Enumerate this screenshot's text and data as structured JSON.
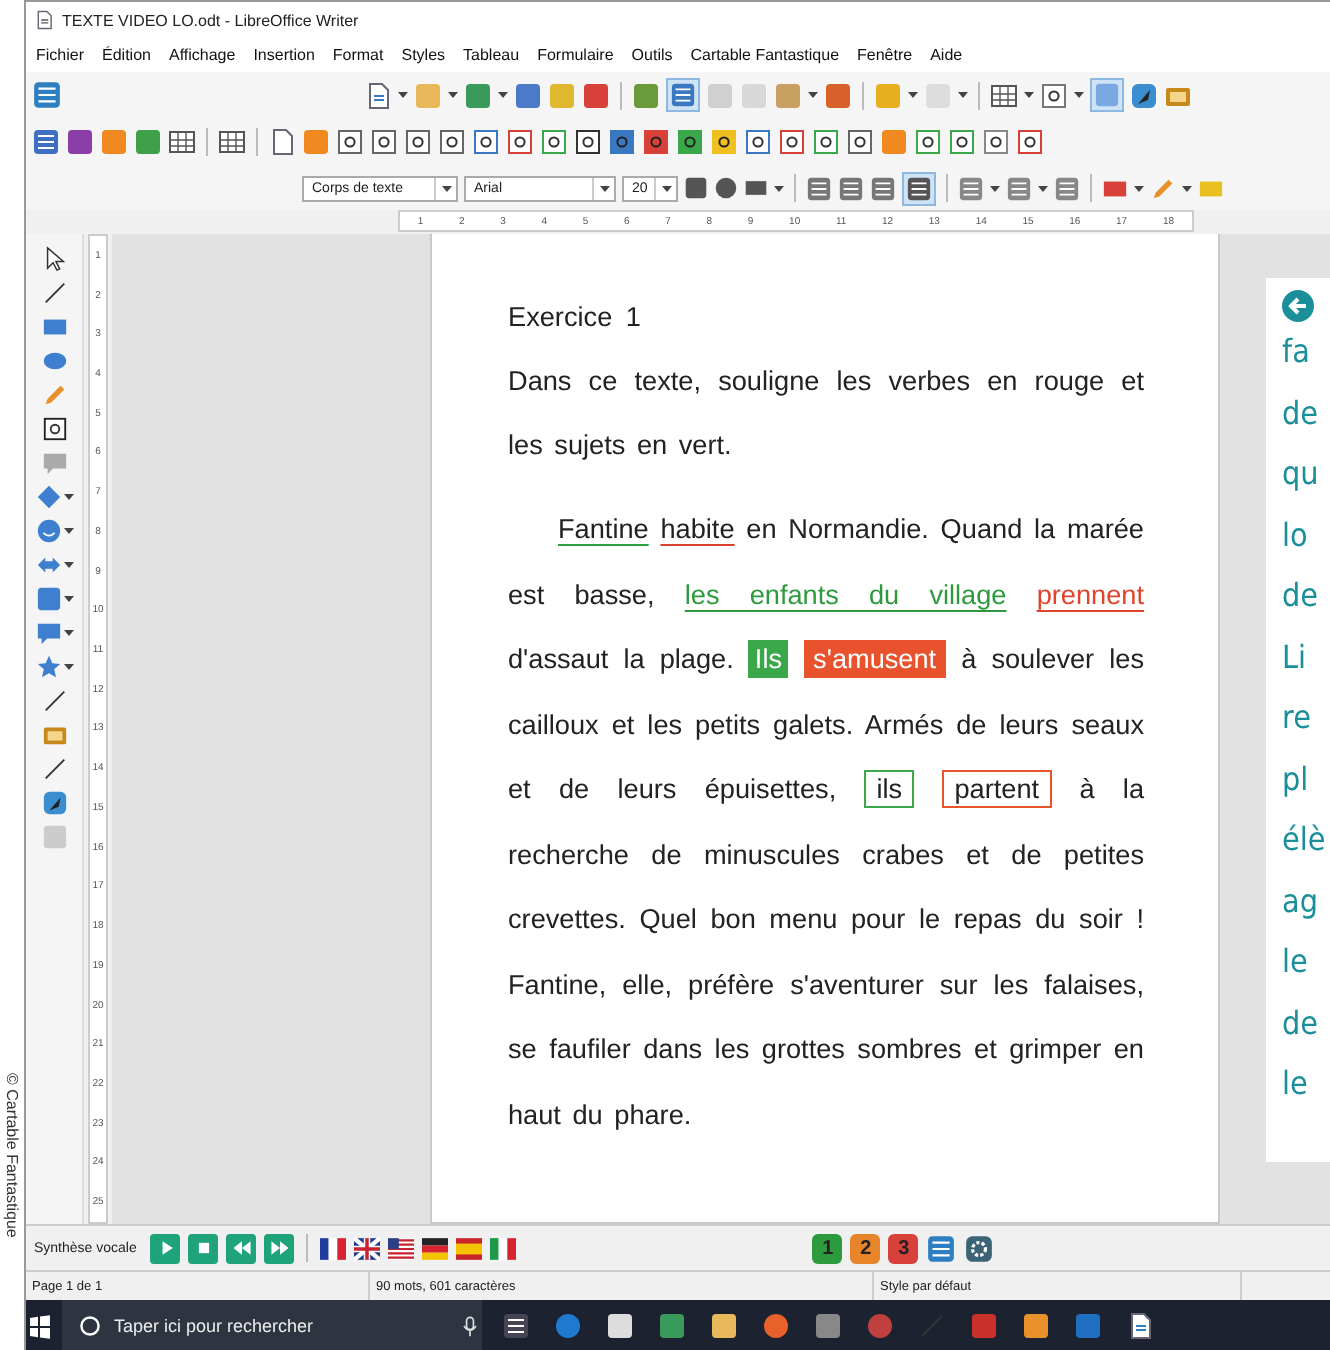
{
  "credit": "© Cartable Fantastique",
  "window": {
    "title": "TEXTE VIDEO LO.odt - LibreOffice Writer"
  },
  "menu": [
    "Fichier",
    "Édition",
    "Affichage",
    "Insertion",
    "Format",
    "Styles",
    "Tableau",
    "Formulaire",
    "Outils",
    "Cartable Fantastique",
    "Fenêtre",
    "Aide"
  ],
  "toggles": {
    "auto_spellcheck": true,
    "view_toggle": true,
    "justify": true
  },
  "format_bar": {
    "paragraph_style": "Corps de texte",
    "font": "Arial",
    "size": "20"
  },
  "ruler_h": [
    "1",
    "2",
    "3",
    "4",
    "5",
    "6",
    "7",
    "8",
    "9",
    "10",
    "11",
    "12",
    "13",
    "14",
    "15",
    "16",
    "17",
    "18"
  ],
  "ruler_v": [
    "1",
    "2",
    "3",
    "4",
    "5",
    "6",
    "7",
    "8",
    "9",
    "10",
    "11",
    "12",
    "13",
    "14",
    "15",
    "16",
    "17",
    "18",
    "19",
    "20",
    "21",
    "22",
    "23",
    "24",
    "25"
  ],
  "document": {
    "heading": "Exercice 1",
    "instruction": "Dans ce texte, souligne les verbes en rouge et les sujets en vert.",
    "segments": [
      {
        "kind": "subject-line",
        "text": "Fantine"
      },
      {
        "kind": "verb-line",
        "text": "habite"
      },
      {
        "kind": "plain",
        "text": " en Normandie. Quand la marée est basse, "
      },
      {
        "kind": "subject-colored",
        "text": "les enfants du village"
      },
      {
        "kind": "verb-colored",
        "text": "prennent"
      },
      {
        "kind": "plain",
        "text": " d'assaut la plage. "
      },
      {
        "kind": "subject-fill",
        "text": "Ils"
      },
      {
        "kind": "verb-fill",
        "text": "s'amusent"
      },
      {
        "kind": "plain",
        "text": " à soulever les cailloux et les petits galets. Armés de leurs seaux et de leurs épuisettes, "
      },
      {
        "kind": "subject-frame",
        "text": "ils"
      },
      {
        "kind": "verb-frame",
        "text": "partent"
      },
      {
        "kind": "plain",
        "text": " à la recherche de minuscules crabes et de petites crevettes. Quel bon menu pour le repas du soir ! Fantine, elle, préfère s'aventurer sur les falaises, se faufiler dans les grottes sombres et grimper en haut du phare."
      }
    ]
  },
  "caption_lines": [
    "fa",
    "de",
    "qu",
    "lo",
    "de",
    "Li",
    "re",
    "pl",
    "élè",
    "ag",
    "le",
    "de",
    "le"
  ],
  "speech_bar": {
    "label": "Synthèse vocale",
    "levels": [
      {
        "text": "1",
        "color": "#2e9a3e"
      },
      {
        "text": "2",
        "color": "#e8852a"
      },
      {
        "text": "3",
        "color": "#d8403a"
      }
    ]
  },
  "status_bar": [
    "Page 1 de 1",
    "90 mots, 601 caractères",
    "Style par défaut"
  ],
  "taskbar": {
    "search_placeholder": "Taper ici pour rechercher"
  }
}
